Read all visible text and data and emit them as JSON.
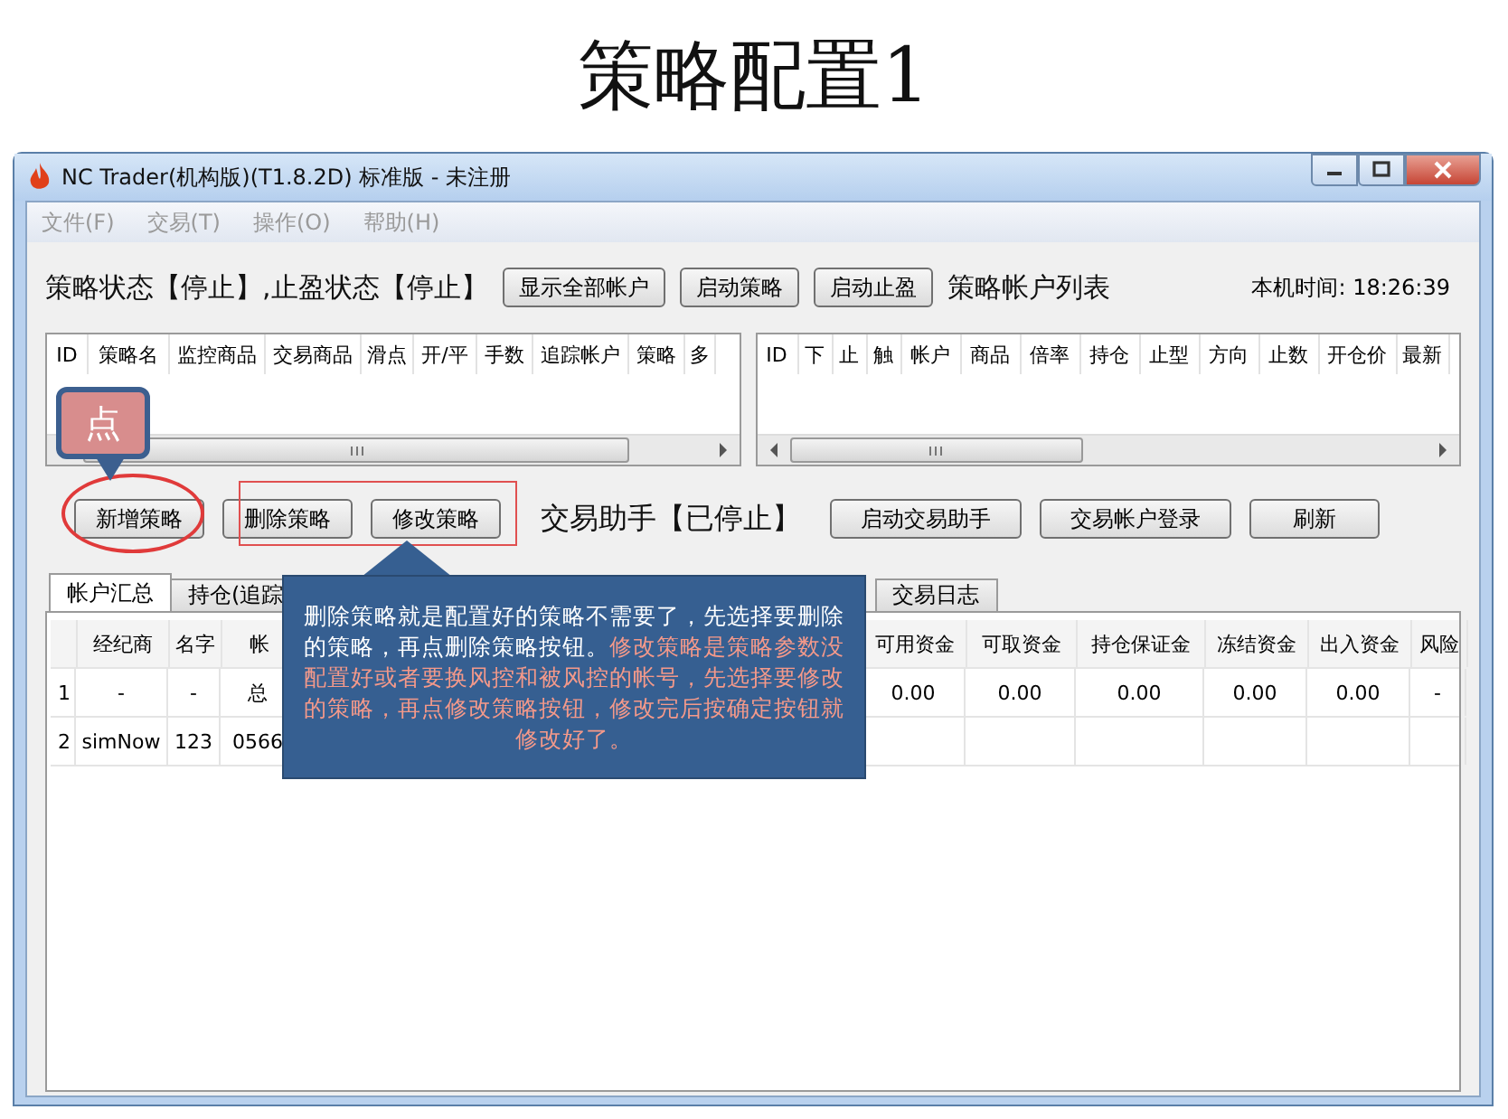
{
  "slide_title": "策略配置1",
  "window": {
    "title": "NC Trader(机构版)(T1.8.2D) 标准版 - 未注册"
  },
  "menu": [
    {
      "label": "文件(F)",
      "disabled": true
    },
    {
      "label": "交易(T)",
      "disabled": true
    },
    {
      "label": "操作(O)",
      "disabled": true
    },
    {
      "label": "帮助(H)",
      "disabled": true
    }
  ],
  "status_line": "策略状态【停止】,止盈状态【停止】",
  "top_buttons": [
    "显示全部帐户",
    "启动策略",
    "启动止盈"
  ],
  "account_list_title": "策略帐户列表",
  "clock": "本机时间: 18:26:39",
  "strategy_table": {
    "columns": [
      "ID",
      "策略名",
      "监控商品",
      "交易商品",
      "滑点",
      "开/平",
      "手数",
      "追踪帐户",
      "策略",
      "多"
    ]
  },
  "stop_table": {
    "columns": [
      "ID",
      "下",
      "止",
      "触",
      "帐户",
      "商品",
      "倍率",
      "持仓",
      "止型",
      "方向",
      "止数",
      "开仓价",
      "最新"
    ]
  },
  "action_buttons": [
    "新增策略",
    "删除策略",
    "修改策略"
  ],
  "assistant_status": "交易助手【已停止】",
  "assistant_buttons": [
    "启动交易助手",
    "交易帐户登录",
    "刷新"
  ],
  "tabs": [
    {
      "label": "帐户汇总",
      "selected": true
    },
    {
      "label": "持仓(追踪",
      "selected": false
    },
    {
      "label": "交易日志",
      "selected": false
    }
  ],
  "summary_table": {
    "columns": [
      "",
      "经纪商",
      "名字",
      "帐",
      "可用资金",
      "可取资金",
      "持仓保证金",
      "冻结资金",
      "出入资金",
      "风险"
    ],
    "rows": [
      [
        "1",
        "-",
        "-",
        "总",
        "0.00",
        "0.00",
        "0.00",
        "0.00",
        "0.00",
        "-"
      ],
      [
        "2",
        "simNow",
        "123",
        "0566",
        null,
        null,
        null,
        null,
        null,
        null
      ]
    ]
  },
  "tap_hint": "点",
  "callout": {
    "text": "删除策略就是配置好的策略不需要了，先选择要删除的策略，再点删除策略按钮。",
    "highlight": "修改策略是策略参数没配置好或者要换风控和被风控的帐号，先选择要修改的策略，再点修改策略按钮，修改完后按确定按钮就修改好了。"
  }
}
